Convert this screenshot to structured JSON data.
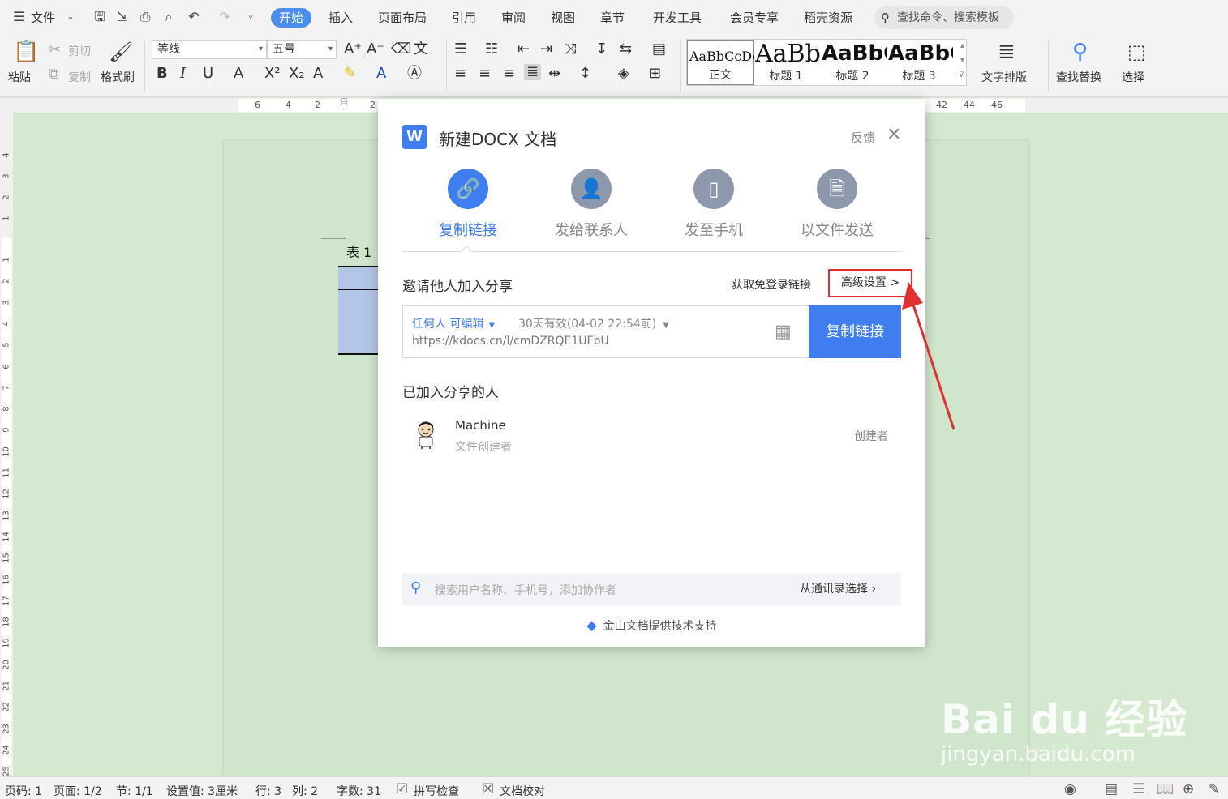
{
  "menubar": {
    "file_menu": "文件",
    "tabs": [
      "开始",
      "插入",
      "页面布局",
      "引用",
      "审阅",
      "视图",
      "章节",
      "开发工具",
      "会员专享",
      "稻壳资源"
    ],
    "active_tab": "开始",
    "search_placeholder": "查找命令、搜索模板"
  },
  "ribbon": {
    "paste": "粘贴",
    "cut": "剪切",
    "copy": "复制",
    "format_painter": "格式刷",
    "font_name": "等线",
    "font_size": "五号",
    "text_layout": "文字排版",
    "find_replace": "查找替换",
    "select": "选择",
    "styles": [
      {
        "sample": "AaBbCcDd",
        "name": "正文"
      },
      {
        "sample": "AaBb",
        "name": "标题 1"
      },
      {
        "sample": "AaBbC",
        "name": "标题 2"
      },
      {
        "sample": "AaBbC",
        "name": "标题 3"
      }
    ]
  },
  "ruler": {
    "h_ticks_left": [
      "6",
      "4",
      "2"
    ],
    "h_tick_mid": "2",
    "h_ticks_right": [
      "42",
      "44",
      "46"
    ],
    "v_ticks_top": [
      "4",
      "3",
      "2",
      "1"
    ],
    "v_ticks_page": [
      "1",
      "2",
      "3",
      "4",
      "5",
      "6",
      "7",
      "8",
      "9",
      "10",
      "11",
      "12",
      "13",
      "14",
      "15",
      "16",
      "17",
      "18",
      "19",
      "20",
      "21",
      "22",
      "23",
      "24",
      "25"
    ]
  },
  "document": {
    "table_caption": "表 1"
  },
  "dialog": {
    "logo": "W",
    "title": "新建DOCX 文档",
    "feedback": "反馈",
    "tabs": [
      {
        "label": "复制链接",
        "icon": "link-icon",
        "active": true
      },
      {
        "label": "发给联系人",
        "icon": "person-icon",
        "active": false
      },
      {
        "label": "发至手机",
        "icon": "phone-icon",
        "active": false
      },
      {
        "label": "以文件发送",
        "icon": "file-icon",
        "active": false
      }
    ],
    "invite_title": "邀请他人加入分享",
    "free_login_link": "获取免登录链接",
    "advanced_settings": "高级设置 >",
    "permission": "任何人 可编辑",
    "validity": "30天有效(04-02 22:54前)",
    "share_url": "https://kdocs.cn/l/cmDZRQE1UFbU",
    "copy_button": "复制链接",
    "joined_title": "已加入分享的人",
    "member": {
      "name": "Machine",
      "subtitle": "文件创建者",
      "role": "创建者"
    },
    "collab_search_placeholder": "搜索用户名称、手机号，添加协作者",
    "from_contacts": "从通讯录选择",
    "powered_by": "金山文档提供技术支持"
  },
  "statusbar": {
    "page_num": "页码: 1",
    "pages": "页面: 1/2",
    "section": "节: 1/1",
    "position": "设置值: 3厘米",
    "row": "行: 3",
    "col": "列: 2",
    "word_count": "字数: 31",
    "spell_check": "拼写检查",
    "proofread": "文档校对"
  },
  "watermark": {
    "brand": "Bai du 经验",
    "site": "jingyan.baidu.com"
  },
  "colors": {
    "accent": "#3e7ef0",
    "highlight_box": "#e03030",
    "page_bg": "#cfe6cd"
  }
}
